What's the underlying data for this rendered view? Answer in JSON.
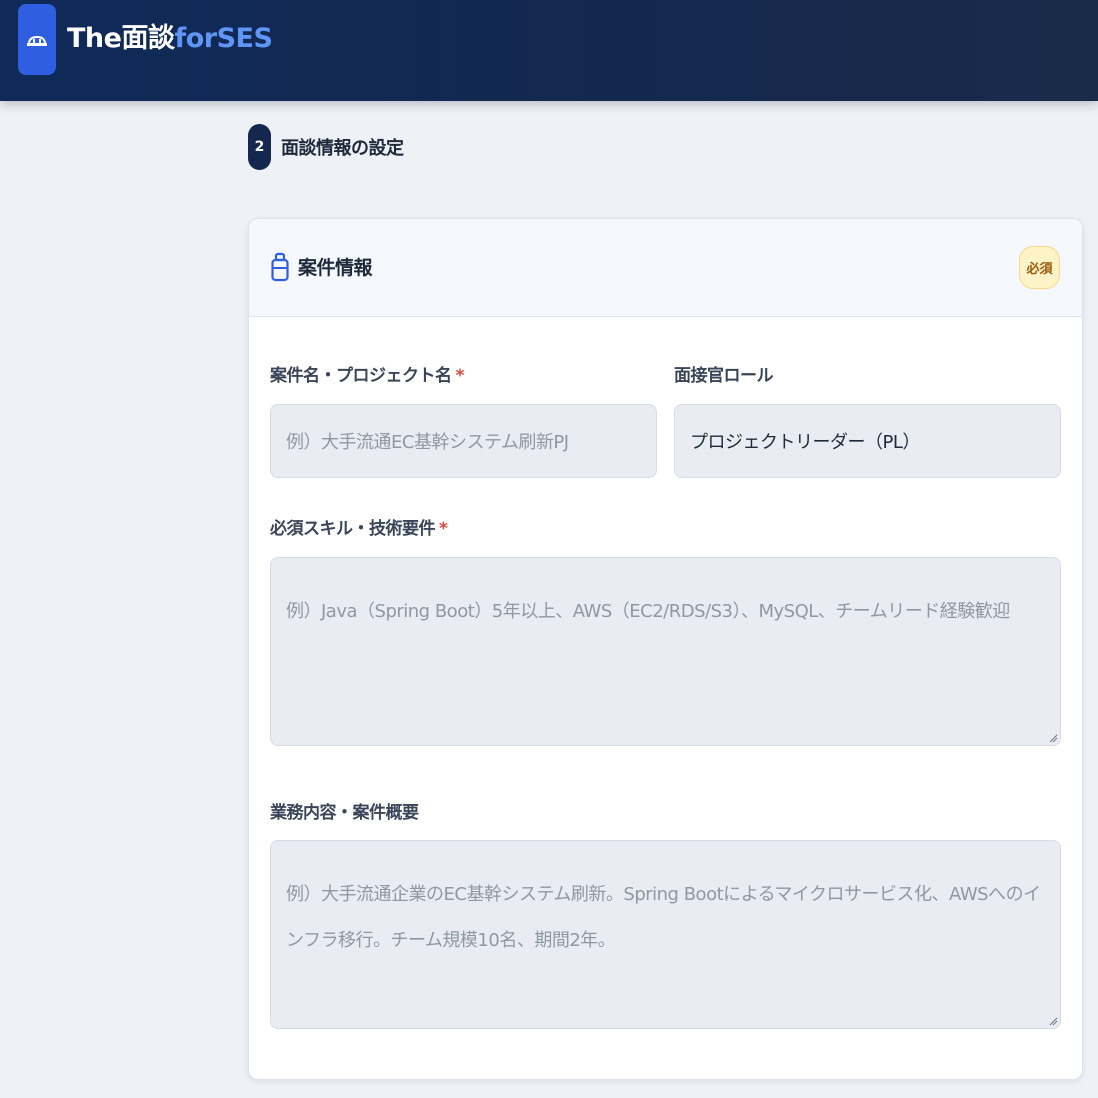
{
  "header": {
    "brand_main": "The面談",
    "brand_accent": "forSES",
    "logo_icon": "cloud-bridge-icon"
  },
  "step": {
    "number": "2",
    "title": "面談情報の設定"
  },
  "card": {
    "icon": "briefcase-icon",
    "title": "案件情報",
    "badge": "必須"
  },
  "fields": {
    "project_name": {
      "label": "案件名・プロジェクト名",
      "required_mark": "*",
      "placeholder": "例）大手流通EC基幹システム刷新PJ"
    },
    "interviewer_role": {
      "label": "面接官ロール",
      "value": "プロジェクトリーダー（PL）"
    },
    "required_skills": {
      "label": "必須スキル・技術要件",
      "required_mark": "*",
      "placeholder": "例）Java（Spring Boot）5年以上、AWS（EC2/RDS/S3）、MySQL、チームリード経験歓迎"
    },
    "job_description": {
      "label": "業務内容・案件概要",
      "placeholder": "例）大手流通企業のEC基幹システム刷新。Spring Bootによるマイクロサービス化、AWSへのインフラ移行。チーム規模10名、期間2年。"
    }
  },
  "colors": {
    "header_bg": "#14284f",
    "brand_accent": "#5f95f5",
    "logo_bg": "#2f5fe0",
    "required": "#e0463a",
    "badge_bg": "#fdf3c7"
  }
}
